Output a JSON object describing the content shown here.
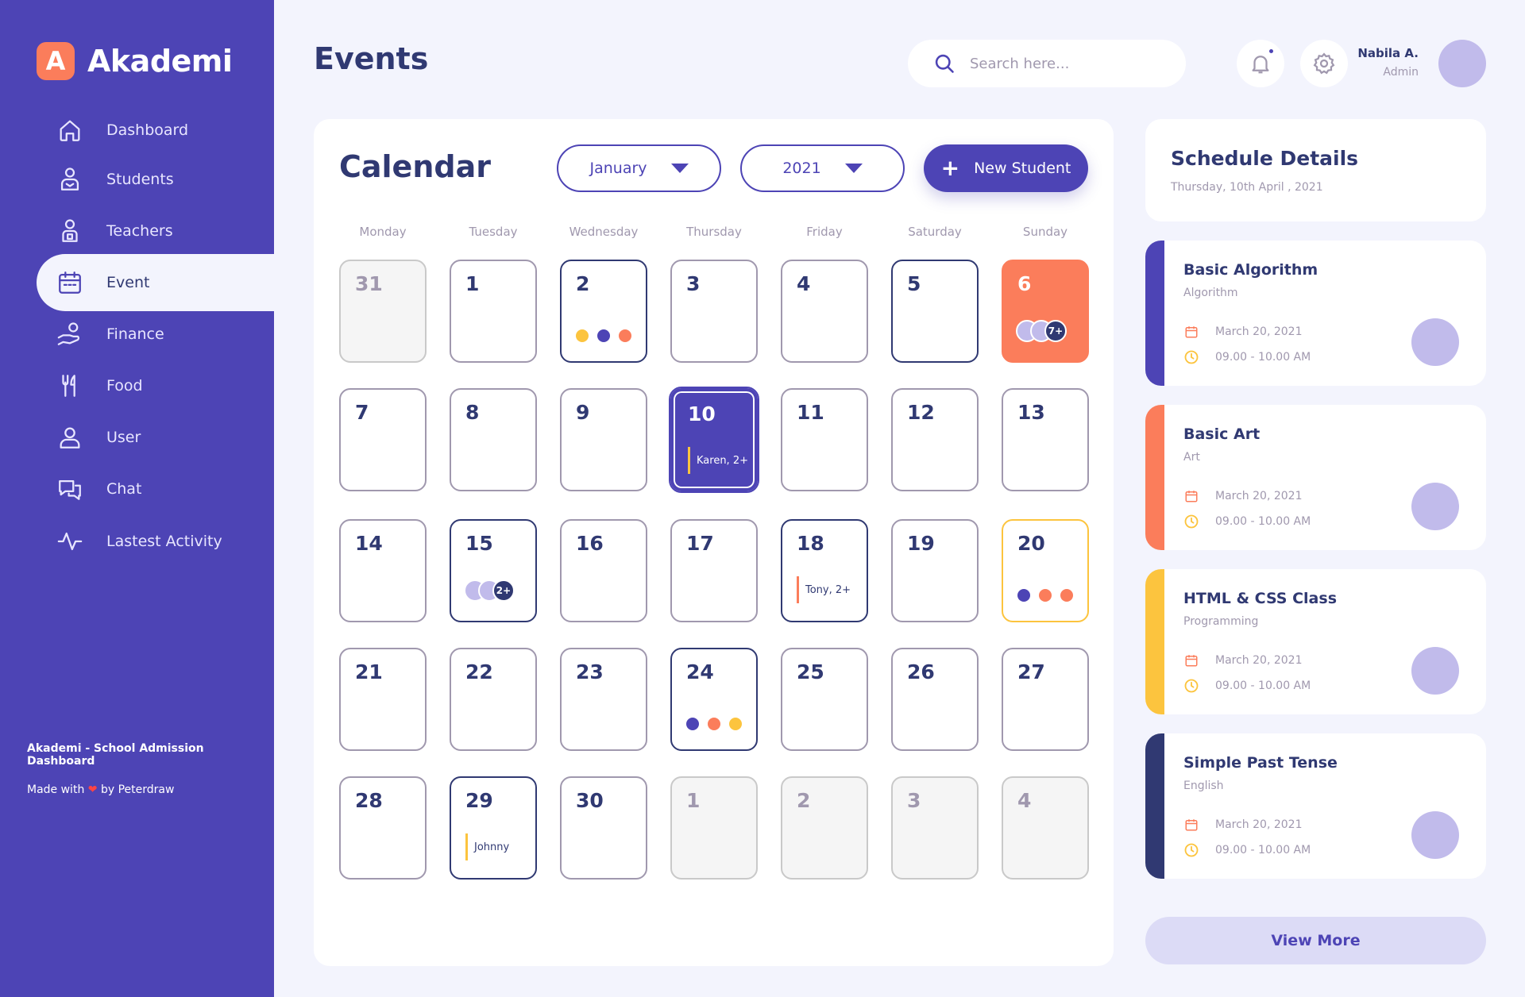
{
  "brand": {
    "logo_letter": "A",
    "name": "Akademi",
    "accent": "#4D44B5",
    "orange": "#FB7D5B",
    "yellow": "#FCC43E",
    "navy": "#303972"
  },
  "sidebar": {
    "items": [
      {
        "label": "Dashboard",
        "icon": "home-icon"
      },
      {
        "label": "Students",
        "icon": "student-icon"
      },
      {
        "label": "Teachers",
        "icon": "teacher-icon"
      },
      {
        "label": "Event",
        "icon": "calendar-icon",
        "active": true
      },
      {
        "label": "Finance",
        "icon": "finance-icon"
      },
      {
        "label": "Food",
        "icon": "food-icon"
      },
      {
        "label": "User",
        "icon": "user-icon"
      },
      {
        "label": "Chat",
        "icon": "chat-icon"
      },
      {
        "label": "Lastest Activity",
        "icon": "activity-icon"
      }
    ],
    "footer_title": "Akademi - School Admission Dashboard",
    "footer_made_pre": "Made with",
    "footer_heart": "❤",
    "footer_made_post": "by Peterdraw"
  },
  "header": {
    "title": "Events",
    "search_placeholder": "Search here...",
    "user_name": "Nabila A.",
    "user_role": "Admin"
  },
  "calendar": {
    "title": "Calendar",
    "month": "January",
    "year": "2021",
    "new_button": "New Student",
    "weekdays": [
      "Monday",
      "Tuesday",
      "Wednesday",
      "Thursday",
      "Friday",
      "Saturday",
      "Sunday"
    ],
    "days": [
      {
        "n": "31",
        "style": "muted"
      },
      {
        "n": "1"
      },
      {
        "n": "2",
        "style": "bold",
        "dots": [
          "#FCC43E",
          "#4D44B5",
          "#FB7D5B"
        ]
      },
      {
        "n": "3"
      },
      {
        "n": "4"
      },
      {
        "n": "5",
        "style": "bold"
      },
      {
        "n": "6",
        "style": "orange",
        "avatars": "7+"
      },
      {
        "n": "7"
      },
      {
        "n": "8"
      },
      {
        "n": "9"
      },
      {
        "n": "10",
        "style": "selected",
        "event": "Karen, 2+",
        "event_color": "#FCC43E"
      },
      {
        "n": "11"
      },
      {
        "n": "12"
      },
      {
        "n": "13"
      },
      {
        "n": "14"
      },
      {
        "n": "15",
        "style": "bold",
        "avatars": "2+"
      },
      {
        "n": "16"
      },
      {
        "n": "17"
      },
      {
        "n": "18",
        "style": "bold",
        "event": "Tony, 2+",
        "event_color": "#FB7D5B"
      },
      {
        "n": "19"
      },
      {
        "n": "20",
        "style": "yellow",
        "dots": [
          "#4D44B5",
          "#FB7D5B",
          "#FB7D5B"
        ]
      },
      {
        "n": "21"
      },
      {
        "n": "22"
      },
      {
        "n": "23"
      },
      {
        "n": "24",
        "style": "bold",
        "dots": [
          "#4D44B5",
          "#FB7D5B",
          "#FCC43E"
        ]
      },
      {
        "n": "25"
      },
      {
        "n": "26"
      },
      {
        "n": "27"
      },
      {
        "n": "28"
      },
      {
        "n": "29",
        "style": "bold",
        "event": "Johnny",
        "event_color": "#FCC43E"
      },
      {
        "n": "30"
      },
      {
        "n": "1",
        "style": "muted"
      },
      {
        "n": "2",
        "style": "muted"
      },
      {
        "n": "3",
        "style": "muted"
      },
      {
        "n": "4",
        "style": "muted"
      }
    ]
  },
  "schedule": {
    "title": "Schedule Details",
    "date": "Thursday, 10th April , 2021",
    "items": [
      {
        "title": "Basic Algorithm",
        "subject": "Algorithm",
        "date": "March 20, 2021",
        "time": "09.00 - 10.00 AM",
        "color": "#4D44B5"
      },
      {
        "title": "Basic Art",
        "subject": "Art",
        "date": "March 20, 2021",
        "time": "09.00 - 10.00 AM",
        "color": "#FB7D5B"
      },
      {
        "title": "HTML & CSS Class",
        "subject": "Programming",
        "date": "March 20, 2021",
        "time": "09.00 - 10.00 AM",
        "color": "#FCC43E"
      },
      {
        "title": "Simple Past Tense",
        "subject": "English",
        "date": "March 20, 2021",
        "time": "09.00 - 10.00 AM",
        "color": "#303972"
      }
    ],
    "view_more": "View More"
  }
}
